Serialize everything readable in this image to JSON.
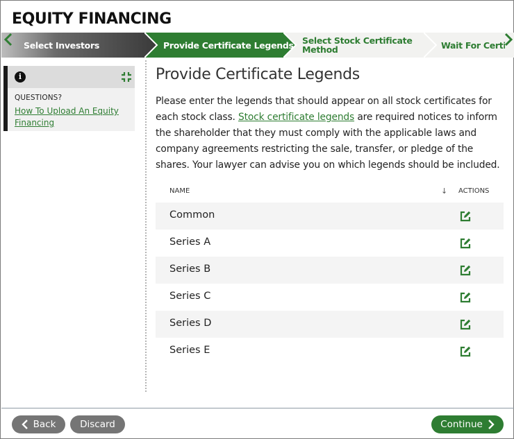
{
  "app": {
    "title": "EQUITY FINANCING"
  },
  "steps": [
    {
      "label": "Select Investors",
      "state": "completed"
    },
    {
      "label": "Provide Certificate Legends",
      "state": "active"
    },
    {
      "label_line1": "Select Stock Certificate",
      "label_line2": "Method",
      "state": "upcoming"
    },
    {
      "label": "Wait For Certifi",
      "state": "upcoming"
    }
  ],
  "sidebar": {
    "questions_label": "QUESTIONS?",
    "help_link": "How To Upload An Equity Financing",
    "info_icon": "info-icon",
    "collapse_icon": "collapse-icon"
  },
  "main": {
    "heading": "Provide Certificate Legends",
    "intro_part1": "Please enter the legends that should appear on all stock certificates for each stock class. ",
    "intro_link": "Stock certificate legends",
    "intro_part2": " are required notices to inform the shareholder that they must comply with the applicable laws and company agreements restricting the sale, transfer, or pledge of the shares. Your lawyer can advise you on which legends should be included."
  },
  "table": {
    "col_name": "NAME",
    "col_sort_icon": "↓",
    "col_actions": "ACTIONS",
    "rows": [
      "Common",
      "Series A",
      "Series B",
      "Series C",
      "Series D",
      "Series E"
    ]
  },
  "footer": {
    "back": "Back",
    "discard": "Discard",
    "continue": "Continue"
  },
  "colors": {
    "brand_green": "#2e7d32",
    "completed_step": "#4a4a4a",
    "upcoming_step": "#f2f2f0",
    "button_gray": "#757575"
  }
}
